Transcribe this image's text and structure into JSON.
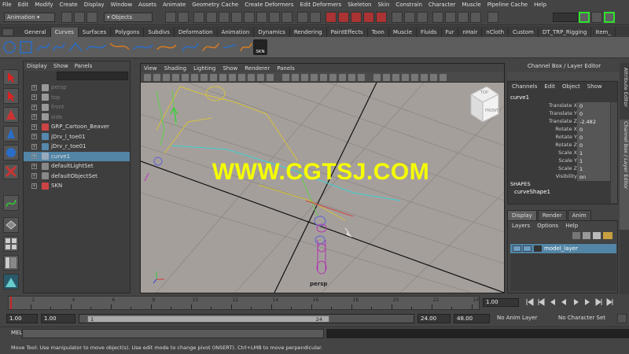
{
  "menu": [
    "File",
    "Edit",
    "Modify",
    "Create",
    "Display",
    "Window",
    "Assets",
    "Animate",
    "Geometry Cache",
    "Create Deformers",
    "Edit Deformers",
    "Skeleton",
    "Skin",
    "Constrain",
    "Character",
    "Muscle",
    "Pipeline Cache",
    "Help"
  ],
  "status": {
    "mode": "Animation",
    "select_mode": "Objects"
  },
  "shelf_tabs": [
    "General",
    "Curves",
    "Surfaces",
    "Polygons",
    "Subdivs",
    "Deformation",
    "Animation",
    "Dynamics",
    "Rendering",
    "PaintEffects",
    "Toon",
    "Muscle",
    "Fluids",
    "Fur",
    "nHair",
    "nCloth",
    "Custom",
    "DT_TRP_Rigging",
    "Item_"
  ],
  "shelf_active": "Curves",
  "shelf_skn_label": "SKN",
  "outliner": {
    "menu": [
      "Display",
      "Show",
      "Panels"
    ],
    "items": [
      {
        "label": "persp",
        "dim": true,
        "icon": "camera-icon"
      },
      {
        "label": "top",
        "dim": true,
        "icon": "camera-icon"
      },
      {
        "label": "front",
        "dim": true,
        "icon": "camera-icon"
      },
      {
        "label": "side",
        "dim": true,
        "icon": "camera-icon"
      },
      {
        "label": "GRP_Cartoon_Beaver",
        "dim": false,
        "icon": "group-icon"
      },
      {
        "label": "jDrv_l_toe01",
        "dim": false,
        "icon": "joint-icon"
      },
      {
        "label": "jDrv_r_toe01",
        "dim": false,
        "icon": "joint-icon"
      },
      {
        "label": "curve1",
        "dim": false,
        "icon": "curve-icon",
        "selected": true
      },
      {
        "label": "defaultLightSet",
        "dim": false,
        "icon": "set-icon"
      },
      {
        "label": "defaultObjectSet",
        "dim": false,
        "icon": "set-icon"
      },
      {
        "label": "SKN",
        "dim": false,
        "icon": "group-icon"
      }
    ]
  },
  "viewport": {
    "menu": [
      "View",
      "Shading",
      "Lighting",
      "Show",
      "Renderer",
      "Panels"
    ],
    "camera_label": "persp",
    "cube_top": "TOP",
    "cube_front": "FRONT"
  },
  "channel_box": {
    "title": "Channel Box / Layer Editor",
    "menu": [
      "Channels",
      "Edit",
      "Object",
      "Show"
    ],
    "object": "curve1",
    "attrs": [
      {
        "label": "Translate X",
        "value": "0"
      },
      {
        "label": "Translate Y",
        "value": "0"
      },
      {
        "label": "Translate Z",
        "value": "-2.482"
      },
      {
        "label": "Rotate X",
        "value": "0"
      },
      {
        "label": "Rotate Y",
        "value": "0"
      },
      {
        "label": "Rotate Z",
        "value": "0"
      },
      {
        "label": "Scale X",
        "value": "1"
      },
      {
        "label": "Scale Y",
        "value": "1"
      },
      {
        "label": "Scale Z",
        "value": "1"
      },
      {
        "label": "Visibility",
        "value": "on"
      }
    ],
    "shapes_header": "SHAPES",
    "shape": "curveShape1"
  },
  "layer_editor": {
    "tabs": [
      "Display",
      "Render",
      "Anim"
    ],
    "menu": [
      "Layers",
      "Options",
      "Help"
    ],
    "layer": "model_layer"
  },
  "side_tabs": [
    "Attribute Editor",
    "Channel Box / Layer Editor"
  ],
  "time_slider": {
    "ticks": [
      "2",
      "4",
      "6",
      "8",
      "10",
      "12",
      "14",
      "16",
      "18",
      "20",
      "22",
      "24"
    ],
    "current_frame": "1.00"
  },
  "range_slider": {
    "start": "1.00",
    "anim_start": "1.00",
    "range_start_label": "1",
    "range_end_label": "24",
    "range_end": "24.00",
    "anim_end": "48.00",
    "anim_layer": "No Anim Layer",
    "character": "No Character Set"
  },
  "command_line": {
    "label": "MEL"
  },
  "help_line": "Move Tool: Use manipulator to move object(s). Use edit mode to change pivot (INSERT). Ctrl+LMB to move perpendicular.",
  "watermark": "WWW.CGTSJ.COM"
}
